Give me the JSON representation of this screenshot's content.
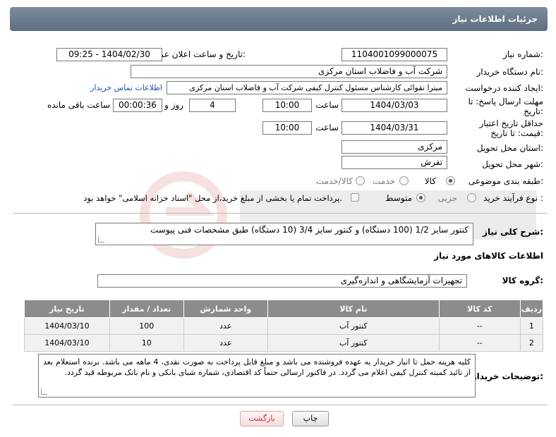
{
  "header": {
    "title": "جزئیات اطلاعات نیاز"
  },
  "form": {
    "need_number": {
      "label": "شماره نیاز:",
      "value": "1104001099000075"
    },
    "announce_date": {
      "label": "تاریخ و ساعت اعلان عمومی:",
      "value": "1404/02/30 - 09:25"
    },
    "buyer_org": {
      "label": "نام دستگاه خریدار:",
      "value": "شرکت آب و فاضلاب استان مرکزی"
    },
    "requester": {
      "label": "ایجاد کننده درخواست:",
      "value": "میترا تقوائی کارشناس مسئول کنترل کیفی شرکت آب و فاضلاب استان مرکزی",
      "link": "اطلاعات تماس خریدار"
    },
    "reply_deadline": {
      "label": "مهلت ارسال پاسخ: تا تاریخ:",
      "date": "1404/03/03",
      "time_label": "ساعت",
      "time": "10:00",
      "days": "4",
      "days_label": "روز و",
      "remaining": "00:00:36",
      "remaining_label": "ساعت باقی مانده"
    },
    "price_validity": {
      "label": "حداقل تاریخ اعتبار قیمت: تا تاریخ:",
      "date": "1404/03/31",
      "time_label": "ساعت",
      "time": "10:00"
    },
    "delivery_province": {
      "label": "استان محل تحویل:",
      "value": "مرکزی"
    },
    "delivery_city": {
      "label": "شهر محل تحویل:",
      "value": "تفرش"
    },
    "category": {
      "label": "طبقه بندی موضوعی:",
      "options": [
        "کالا",
        "خدمت",
        "کالا/خدمت"
      ],
      "selected": "کالا"
    },
    "purchase_type": {
      "label": "نوع فرآیند خرید :",
      "options": [
        "جزیی",
        "متوسط"
      ],
      "selected": "متوسط",
      "note": "پرداخت تمام یا بخشی از مبلغ خرید،از محل \"اسناد خزانه اسلامی\" خواهد بود."
    }
  },
  "description": {
    "label": "شرح کلی نیاز:",
    "value": "کنتور سایز 1/2 (100 دستگاه) و کنتور سایز 3/4 (10 دستگاه) طبق مشخصات فنی پیوست"
  },
  "items_section": {
    "title": "اطلاعات کالاهای مورد نیاز"
  },
  "goods_group": {
    "label": "گروه کالا:",
    "value": "تجهیزات آزمایشگاهی و اندازه‌گیری"
  },
  "table": {
    "headers": [
      "ردیف",
      "کد کالا",
      "نام کالا",
      "واحد شمارش",
      "تعداد / مقدار",
      "تاریخ نیاز"
    ],
    "rows": [
      [
        "1",
        "--",
        "کنتور آب",
        "عدد",
        "100",
        "1404/03/10"
      ],
      [
        "2",
        "--",
        "کنتور آب",
        "عدد",
        "10",
        "1404/03/10"
      ]
    ]
  },
  "buyer_notes": {
    "label": "توضیحات خریدار:",
    "value": "کلیه هزینه حمل تا انبار خریدار به عهده فروشنده می باشد و مبلغ قابل پرداخت به صورت نقدی، 4 ماهه می باشد. برنده استعلام بعد از تائید کمیته کنترل کیفی اعلام می گردد. در فاکتور ارسالی حتماً کد اقتصادی، شماره شبای بانکی و نام بانک مربوطه قید گردد."
  },
  "buttons": {
    "print": "چاپ",
    "back": "بازگشت"
  },
  "colors": {
    "header": "#5d6e80",
    "link": "#1a4fb5",
    "table_header": "#8c8c8c"
  }
}
